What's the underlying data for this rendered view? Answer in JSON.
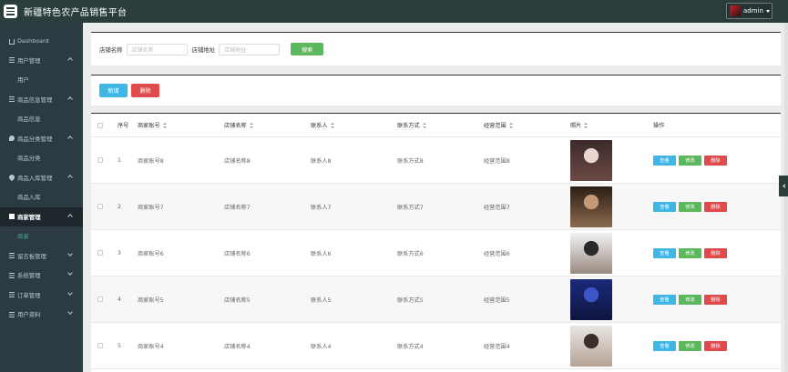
{
  "app": {
    "title": "新疆特色农产品销售平台",
    "user": "admin"
  },
  "sidebar": {
    "items": [
      {
        "label": "Dashboard",
        "icon": "home-icon",
        "type": "top",
        "chevron": ""
      },
      {
        "label": "用户管理",
        "icon": "grid-icon",
        "type": "top",
        "chevron": "up"
      },
      {
        "label": "用户",
        "type": "sub"
      },
      {
        "label": "商品信息管理",
        "icon": "grid-icon",
        "type": "top",
        "chevron": "up"
      },
      {
        "label": "商品信息",
        "type": "sub"
      },
      {
        "label": "商品分类管理",
        "icon": "bubble-icon",
        "type": "top",
        "chevron": "up"
      },
      {
        "label": "商品分类",
        "type": "sub"
      },
      {
        "label": "商品入库管理",
        "icon": "pin-icon",
        "type": "top",
        "chevron": "up"
      },
      {
        "label": "商品入库",
        "type": "sub"
      },
      {
        "label": "商家管理",
        "icon": "tag-icon",
        "type": "top",
        "chevron": "up",
        "active": true
      },
      {
        "label": "商家",
        "type": "sub",
        "active": true
      },
      {
        "label": "留言板管理",
        "icon": "grid-icon",
        "type": "top",
        "chevron": "down"
      },
      {
        "label": "系统管理",
        "icon": "grid-icon",
        "type": "top",
        "chevron": "down"
      },
      {
        "label": "订单管理",
        "icon": "grid-icon",
        "type": "top",
        "chevron": "down"
      },
      {
        "label": "用户资料",
        "icon": "grid-icon",
        "type": "top",
        "chevron": "down"
      }
    ]
  },
  "search": {
    "shop_name_label": "店铺名称",
    "shop_name_placeholder": "店铺名称",
    "shop_addr_label": "店铺地址",
    "shop_addr_placeholder": "店铺地址",
    "search_label": "搜索"
  },
  "actions": {
    "add_label": "新增",
    "delete_label": "删除"
  },
  "table": {
    "headers": {
      "index": "序号",
      "account": "商家账号",
      "shop": "店铺名称",
      "contact": "联系人",
      "phone": "联系方式",
      "scope": "经营范围",
      "photo": "照片",
      "ops": "操作"
    },
    "op_labels": {
      "view": "查看",
      "edit": "修改",
      "delete": "删除"
    },
    "rows": [
      {
        "index": "1",
        "account": "商家账号8",
        "shop": "店铺名称8",
        "contact": "联系人8",
        "phone": "联系方式8",
        "scope": "经营范围8",
        "photo_colors": [
          "#3b2a2a",
          "#e8d6cf",
          "#6b4a45"
        ]
      },
      {
        "index": "2",
        "account": "商家账号7",
        "shop": "店铺名称7",
        "contact": "联系人7",
        "phone": "联系方式7",
        "scope": "经营范围7",
        "photo_colors": [
          "#2b1e14",
          "#c49a78",
          "#8a6a4e"
        ]
      },
      {
        "index": "3",
        "account": "商家账号6",
        "shop": "店铺名称6",
        "contact": "联系人6",
        "phone": "联系方式6",
        "scope": "经营范围6",
        "photo_colors": [
          "#f2f2f2",
          "#2a2a2a",
          "#9a8a80"
        ]
      },
      {
        "index": "4",
        "account": "商家账号5",
        "shop": "店铺名称5",
        "contact": "联系人5",
        "phone": "联系方式5",
        "scope": "经营范围5",
        "photo_colors": [
          "#1a2a7a",
          "#3c55c8",
          "#0f1540"
        ]
      },
      {
        "index": "5",
        "account": "商家账号4",
        "shop": "店铺名称4",
        "contact": "联系人4",
        "phone": "联系方式4",
        "scope": "经营范围4",
        "photo_colors": [
          "#e8e6e2",
          "#3a2e28",
          "#b6a496"
        ]
      }
    ]
  }
}
